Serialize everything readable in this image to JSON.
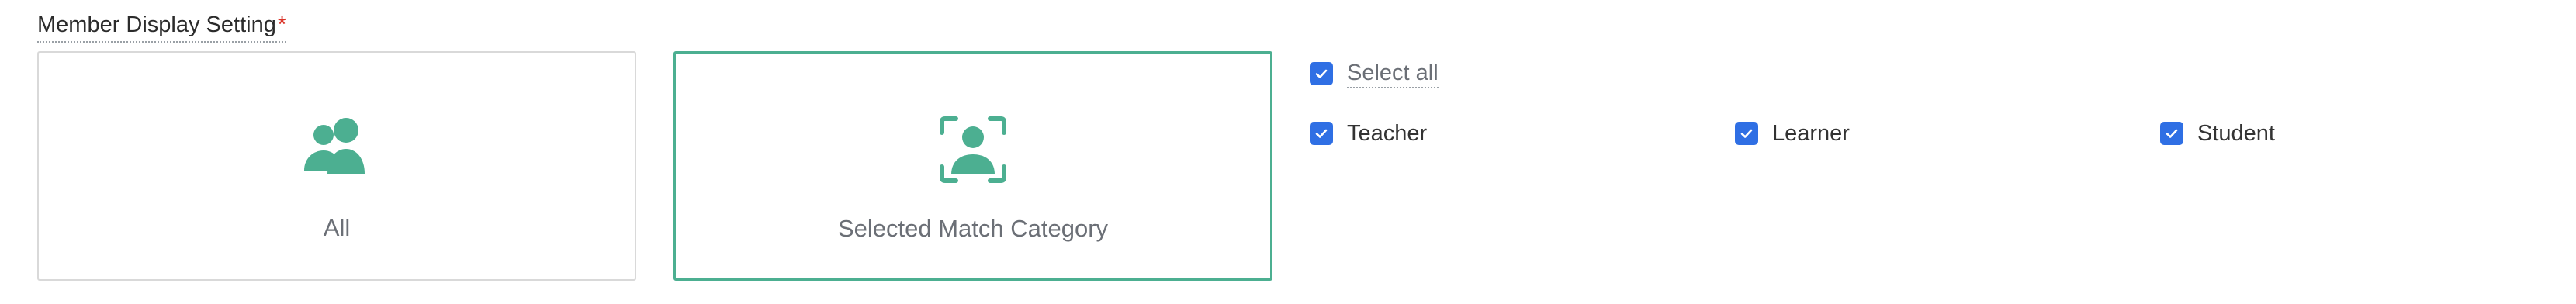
{
  "field": {
    "label": "Member Display Setting",
    "required_marker": "*"
  },
  "options": {
    "all": {
      "label": "All",
      "icon": "group-icon",
      "selected": false
    },
    "selected_match": {
      "label": "Selected Match Category",
      "icon": "person-focus-icon",
      "selected": true
    }
  },
  "select_all": {
    "label": "Select all",
    "checked": true
  },
  "categories": [
    {
      "label": "Teacher",
      "checked": true
    },
    {
      "label": "Learner",
      "checked": true
    },
    {
      "label": "Student",
      "checked": true
    }
  ],
  "colors": {
    "accent_green": "#4caf91",
    "checkbox_blue": "#2f6fe4",
    "required_red": "#d93025"
  }
}
